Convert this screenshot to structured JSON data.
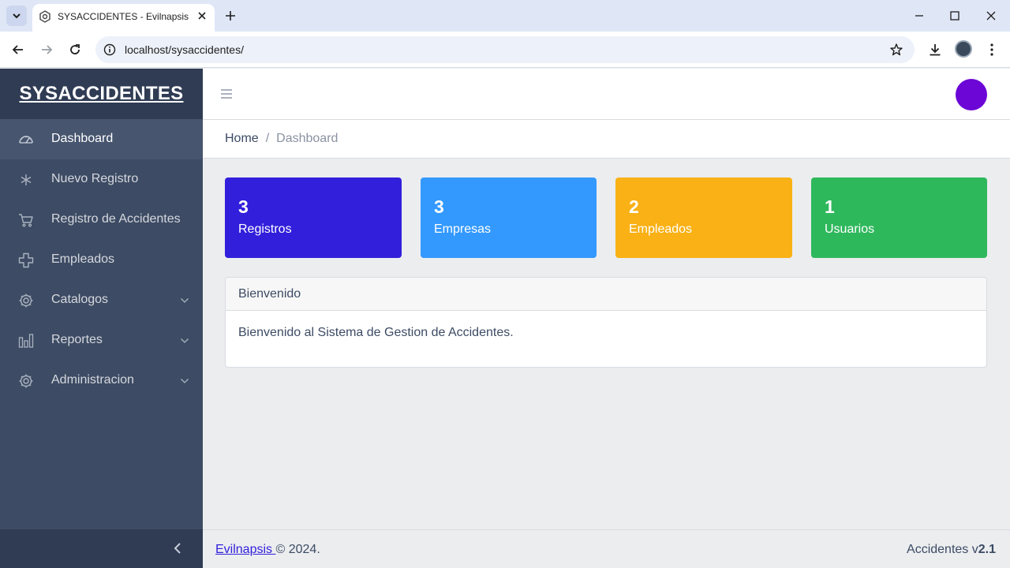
{
  "browser": {
    "tab_title": "SYSACCIDENTES - Evilnapsis",
    "url": "localhost/sysaccidentes/"
  },
  "sidebar": {
    "brand": "SYSACCIDENTES",
    "items": [
      {
        "label": "Dashboard",
        "icon": "speedometer-icon"
      },
      {
        "label": "Nuevo Registro",
        "icon": "asterisk-icon"
      },
      {
        "label": "Registro de Accidentes",
        "icon": "cart-icon"
      },
      {
        "label": "Empleados",
        "icon": "plus-icon"
      },
      {
        "label": "Catalogos",
        "icon": "gear-icon"
      },
      {
        "label": "Reportes",
        "icon": "bar-chart-icon"
      },
      {
        "label": "Administracion",
        "icon": "gear-icon"
      }
    ]
  },
  "header": {
    "avatar_color": "#6b06d6"
  },
  "breadcrumb": {
    "home": "Home",
    "separator": "/",
    "current": "Dashboard"
  },
  "stats": [
    {
      "value": "3",
      "label": "Registros",
      "color": "#321fdb"
    },
    {
      "value": "3",
      "label": "Empresas",
      "color": "#3399ff"
    },
    {
      "value": "2",
      "label": "Empleados",
      "color": "#f9b115"
    },
    {
      "value": "1",
      "label": "Usuarios",
      "color": "#2eb85c"
    }
  ],
  "panel": {
    "title": "Bienvenido",
    "body": "Bienvenido al Sistema de Gestion de Accidentes."
  },
  "footer": {
    "link": "Evilnapsis ",
    "copyright": "© 2024.",
    "app_prefix": "Accidentes v",
    "version": "2.1"
  }
}
